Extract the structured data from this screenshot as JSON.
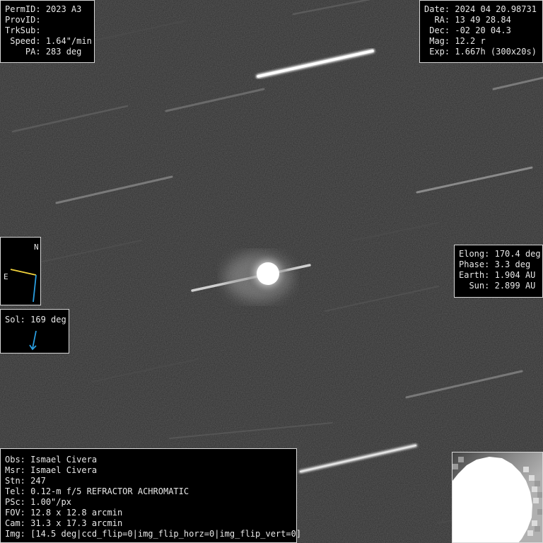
{
  "target_info": [
    {
      "label": "PermID:",
      "value": "2023 A3"
    },
    {
      "label": "ProvID:",
      "value": ""
    },
    {
      "label": "TrkSub:",
      "value": ""
    },
    {
      "label": " Speed:",
      "value": "1.64\"/min"
    },
    {
      "label": "    PA:",
      "value": "283 deg"
    }
  ],
  "observation_info": [
    {
      "label": "Date:",
      "value": "2024 04 20.98731"
    },
    {
      "label": "  RA:",
      "value": "13 49 28.84"
    },
    {
      "label": " Dec:",
      "value": "-02 20 04.3"
    },
    {
      "label": " Mag:",
      "value": "12.2 r"
    },
    {
      "label": " Exp:",
      "value": "1.667h (300x20s)"
    }
  ],
  "geometry_info": [
    {
      "label": "Elong:",
      "value": "170.4 deg"
    },
    {
      "label": "Phase:",
      "value": "3.3 deg"
    },
    {
      "label": "Earth:",
      "value": "1.904 AU"
    },
    {
      "label": "  Sun:",
      "value": "2.899 AU"
    }
  ],
  "observer_info": [
    {
      "label": "Obs:",
      "value": "Ismael Civera"
    },
    {
      "label": "Msr:",
      "value": "Ismael Civera"
    },
    {
      "label": "Stn:",
      "value": "247"
    },
    {
      "label": "Tel:",
      "value": "0.12-m f/5 REFRACTOR ACHROMATIC"
    },
    {
      "label": "PSc:",
      "value": "1.00\"/px"
    },
    {
      "label": "FOV:",
      "value": "12.8 x 12.8 arcmin"
    },
    {
      "label": "Cam:",
      "value": "31.3 x 17.3 arcmin"
    },
    {
      "label": "Img:",
      "value": "[14.5 deg|ccd_flip=0|img_flip_horz=0|img_flip_vert=0]"
    }
  ],
  "compass": {
    "north_label": "N",
    "east_label": "E"
  },
  "sol": {
    "label": "Sol:",
    "value": "169 deg"
  },
  "colors": {
    "east_arrow": "#f2d33c",
    "north_arrow": "#2a9ee0",
    "sol_arrow": "#2a9ee0",
    "border": "#d8d8d8"
  }
}
